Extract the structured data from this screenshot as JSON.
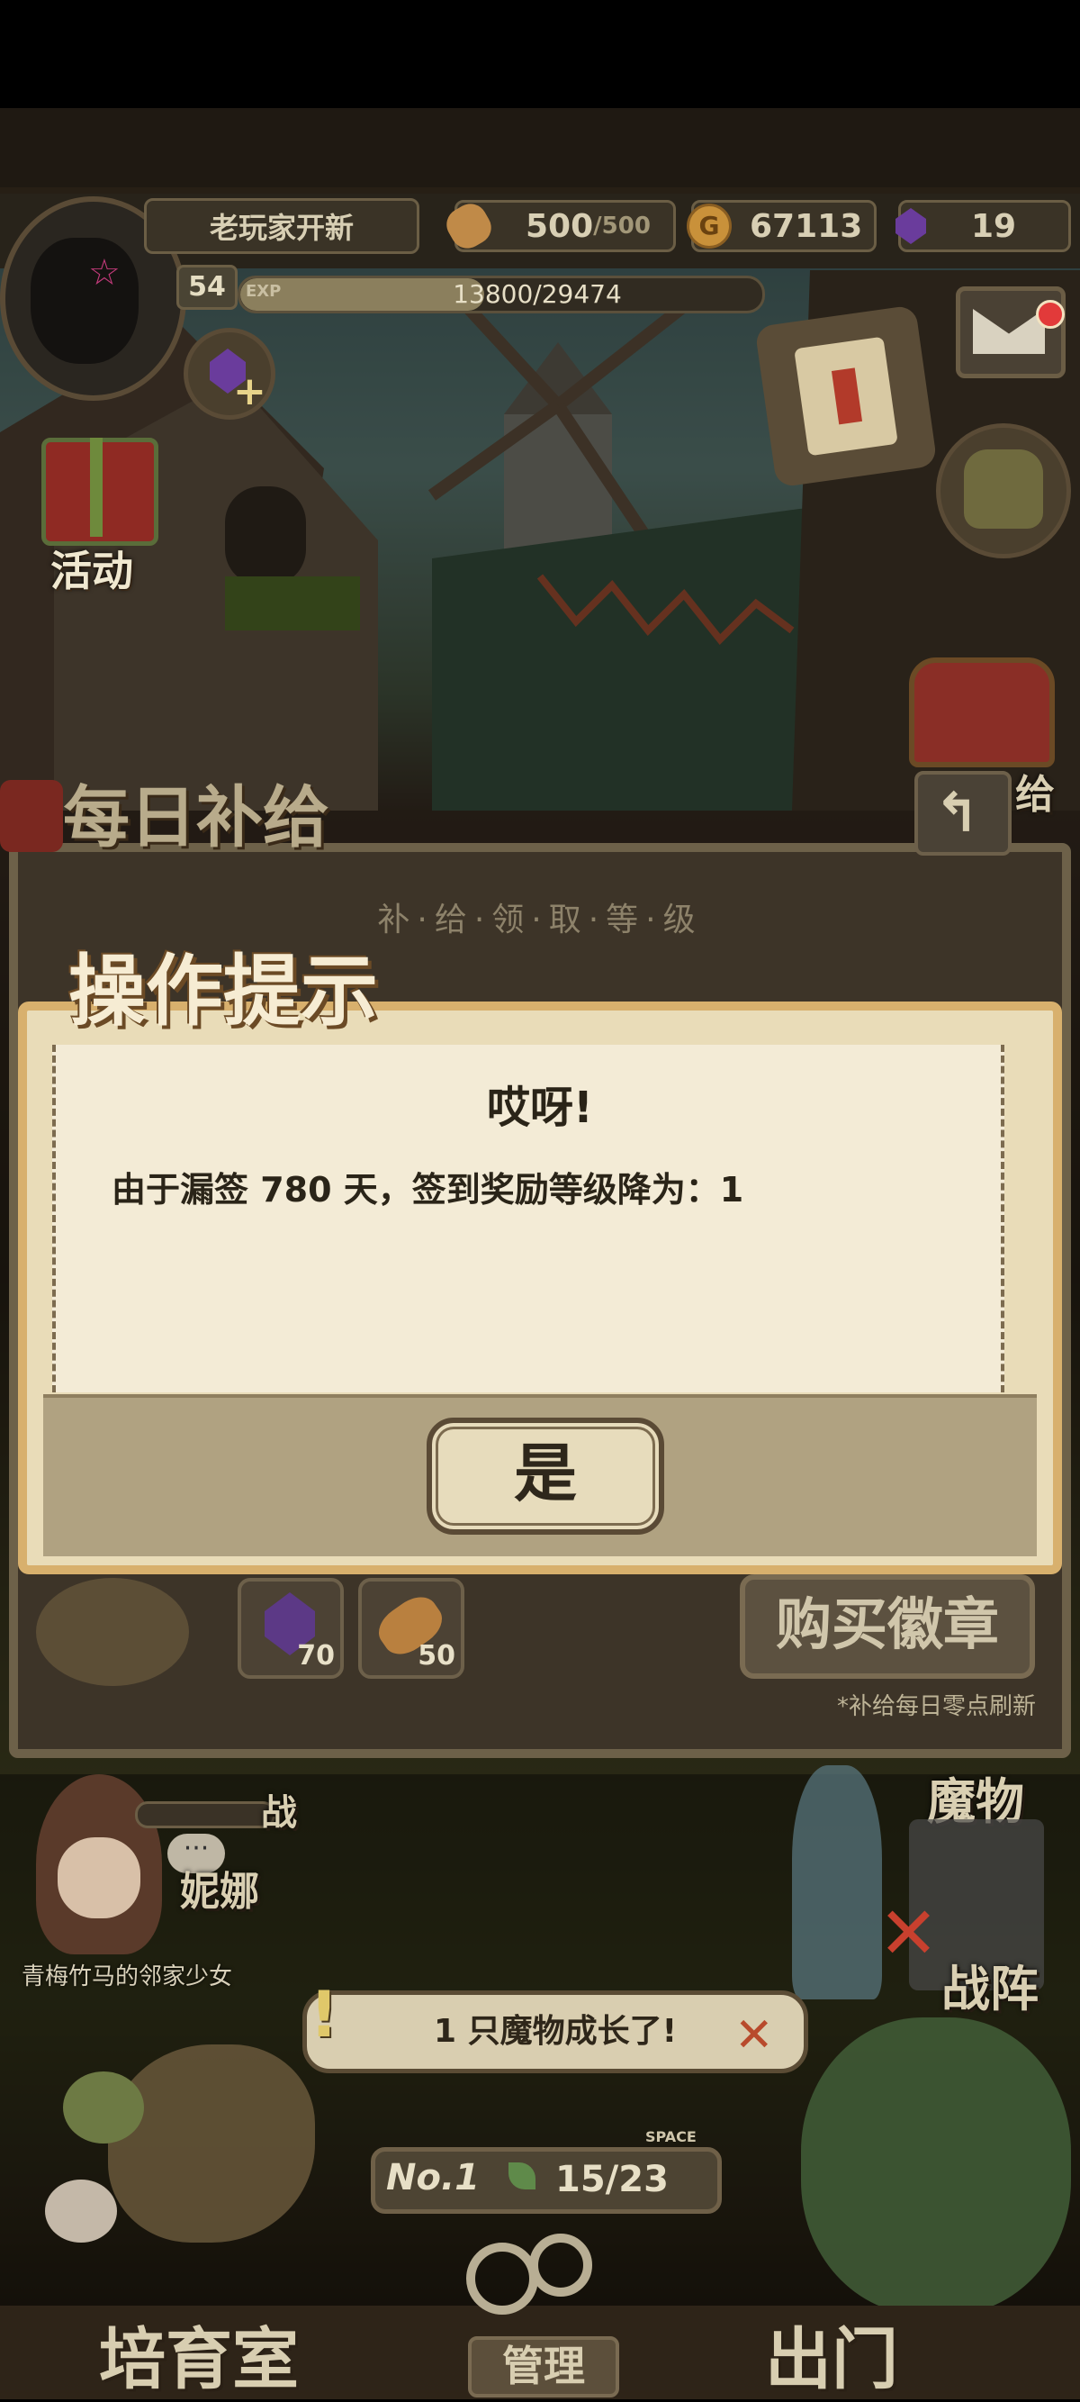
{
  "hud": {
    "player_name": "老玩家开新",
    "stamina": "500",
    "stamina_max": "/500",
    "gold": "67113",
    "gems": "19",
    "level": "54",
    "exp_label": "EXP",
    "exp_text": "13800/29474",
    "exp_fraction": 0.468
  },
  "side_menu": {
    "event_label": "活动",
    "supply_label": "给"
  },
  "daily_panel": {
    "title": "每日补给",
    "subtitle": "补·给·领·取·等·级",
    "items": [
      {
        "icon": "gem-icon",
        "count": "70"
      },
      {
        "icon": "bread-icon",
        "count": "50"
      }
    ],
    "buy_badge_label": "购买徽章",
    "refresh_note": "*补给每日零点刷新"
  },
  "dialog": {
    "title": "操作提示",
    "heading": "哎呀!",
    "message": "由于漏签 780 天，签到奖励等级降为：1",
    "confirm_label": "是"
  },
  "field": {
    "char_name": "妮娜",
    "char_desc": "青梅竹马的邻家少女",
    "battle_label": "战",
    "monster_label": "魔物",
    "formation_label": "战阵",
    "notification": "1 只魔物成长了!",
    "rank": "No.1",
    "space_label": "SPACE",
    "space_count": "15/23"
  },
  "bottom_nav": {
    "breed_room": "培育室",
    "manage": "管理",
    "exit": "出门"
  },
  "colors": {
    "dialog_border": "#d8b06d",
    "dialog_bg": "#f3ebd6",
    "notify_close": "#b84a2c",
    "mail_dot": "#e23a3a"
  }
}
